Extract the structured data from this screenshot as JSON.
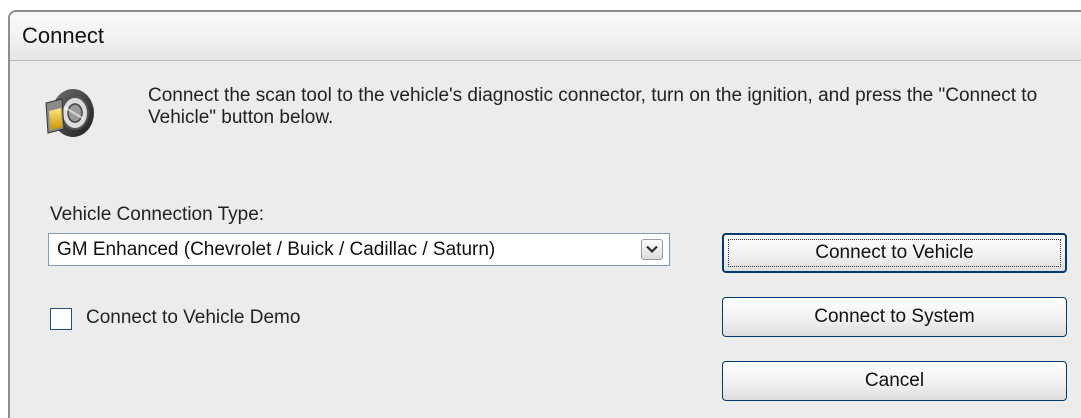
{
  "window": {
    "title": "Connect"
  },
  "icon": "scan-tool-connector-icon",
  "instructions": "Connect the scan tool to the vehicle's diagnostic connector, turn on the ignition, and press the \"Connect to Vehicle\" button below.",
  "connection_type": {
    "label": "Vehicle Connection Type:",
    "selected": "GM Enhanced (Chevrolet / Buick / Cadillac / Saturn)"
  },
  "demo_checkbox": {
    "label": "Connect to Vehicle Demo",
    "checked": false
  },
  "buttons": {
    "connect_vehicle": "Connect to Vehicle",
    "connect_system": "Connect to System",
    "cancel": "Cancel"
  },
  "colors": {
    "button_border": "#003c74",
    "dialog_background": "#ececec"
  }
}
